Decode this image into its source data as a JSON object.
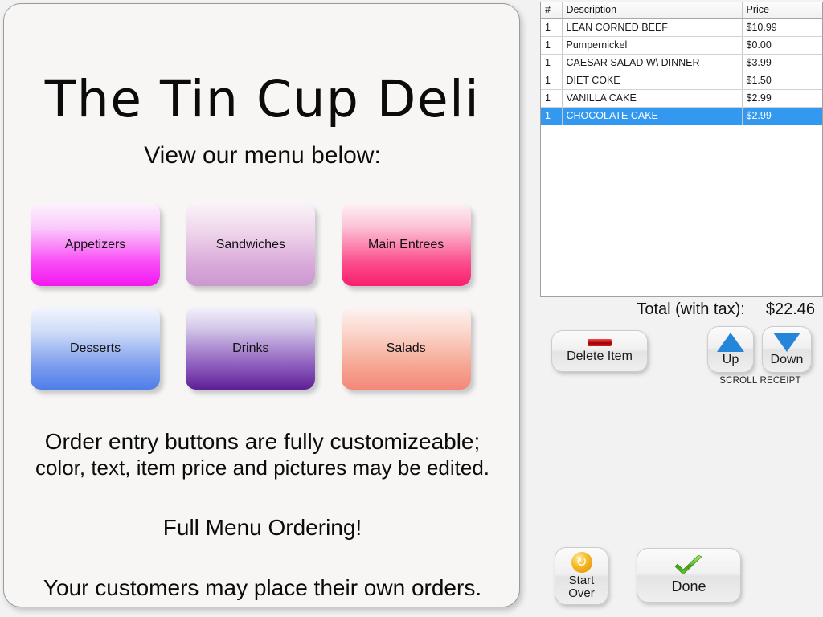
{
  "menu_panel": {
    "title": "The Tin Cup Deli",
    "subtitle": "View our menu below:",
    "categories": [
      {
        "label": "Appetizers",
        "color": "#f317f0"
      },
      {
        "label": "Sandwiches",
        "color": "#cb98d0"
      },
      {
        "label": "Main Entrees",
        "color": "#fa1e6e"
      },
      {
        "label": "Desserts",
        "color": "#4f7ee8"
      },
      {
        "label": "Drinks",
        "color": "#5f1f96"
      },
      {
        "label": "Salads",
        "color": "#f4877a"
      }
    ],
    "promo": {
      "line1": "Order entry buttons are fully customizeable;",
      "line2": "color, text, item price and pictures may be edited.",
      "line3": "Full Menu Ordering!",
      "line4": "Your customers may place their own orders."
    }
  },
  "order_panel": {
    "receipt": {
      "columns": [
        "#",
        "Description",
        "Price"
      ],
      "rows": [
        {
          "qty": "1",
          "description": "LEAN CORNED BEEF",
          "price": "$10.99",
          "indented": false,
          "selected": false
        },
        {
          "qty": "1",
          "description": "Pumpernickel",
          "price": "$0.00",
          "indented": true,
          "selected": false
        },
        {
          "qty": "1",
          "description": "CAESAR SALAD W\\ DINNER",
          "price": "$3.99",
          "indented": true,
          "selected": false
        },
        {
          "qty": "1",
          "description": "DIET COKE",
          "price": "$1.50",
          "indented": false,
          "selected": false
        },
        {
          "qty": "1",
          "description": "VANILLA CAKE",
          "price": "$2.99",
          "indented": false,
          "selected": false
        },
        {
          "qty": "1",
          "description": "CHOCOLATE CAKE",
          "price": "$2.99",
          "indented": false,
          "selected": true
        }
      ],
      "selection_color": "#3399f0"
    },
    "total": {
      "label": "Total (with tax):",
      "value": "$22.46"
    },
    "controls": {
      "delete_item": "Delete Item",
      "up": "Up",
      "down": "Down",
      "scroll_hint": "SCROLL RECEIPT",
      "start_over_line1": "Start",
      "start_over_line2": "Over",
      "done": "Done",
      "start_over_icon": "↻",
      "done_icon": "✔",
      "done_icon_color": "#4cb820"
    }
  }
}
